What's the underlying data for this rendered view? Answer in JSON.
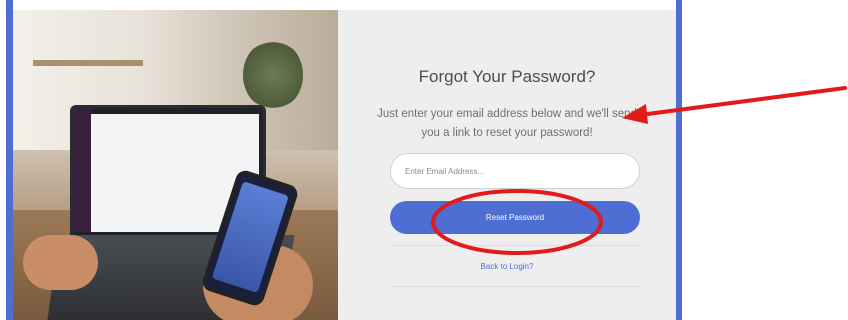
{
  "form": {
    "title": "Forgot Your Password?",
    "description": "Just enter your email address below and we'll send you a link to reset your password!",
    "email_placeholder": "Enter Email Address...",
    "reset_button_label": "Reset Password",
    "back_link_label": "Back to Login?"
  },
  "colors": {
    "accent": "#4f6ed3",
    "panel_background": "#eeeeef",
    "frame_border": "#4e6fd0",
    "annotation": "#e31a1a"
  },
  "icons": [
    "red-arrow-annotation",
    "red-circle-annotation"
  ]
}
